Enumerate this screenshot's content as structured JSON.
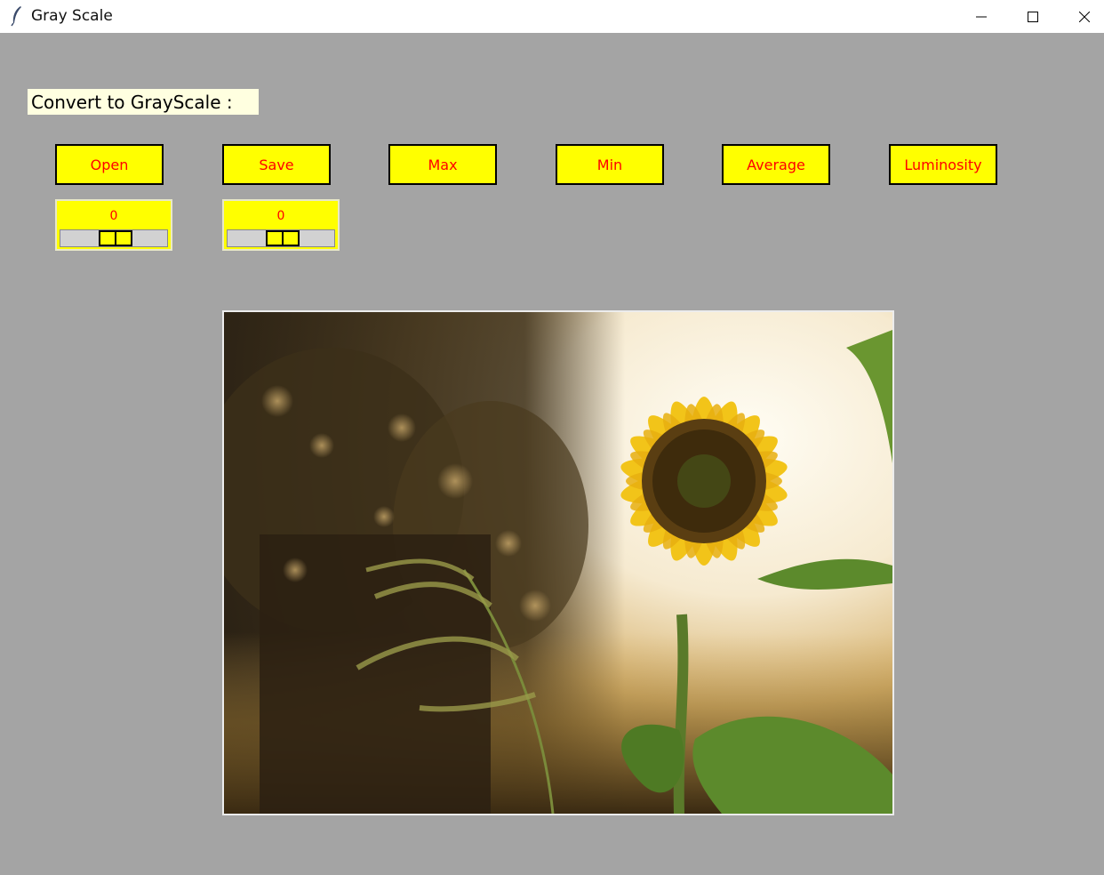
{
  "window": {
    "title": "Gray Scale",
    "icons": [
      "feather-icon",
      "minimize-icon",
      "maximize-icon",
      "close-icon"
    ]
  },
  "heading": {
    "label": "Convert to GrayScale :"
  },
  "buttons": {
    "open": "Open",
    "save": "Save",
    "max": "Max",
    "min": "Min",
    "average": "Average",
    "luminosity": "Luminosity"
  },
  "scales": [
    {
      "value": "0"
    },
    {
      "value": "0"
    }
  ],
  "colors": {
    "background": "#a4a4a4",
    "button_bg": "#ffff00",
    "button_text": "#ff0000",
    "heading_bg": "#ffffe0"
  }
}
